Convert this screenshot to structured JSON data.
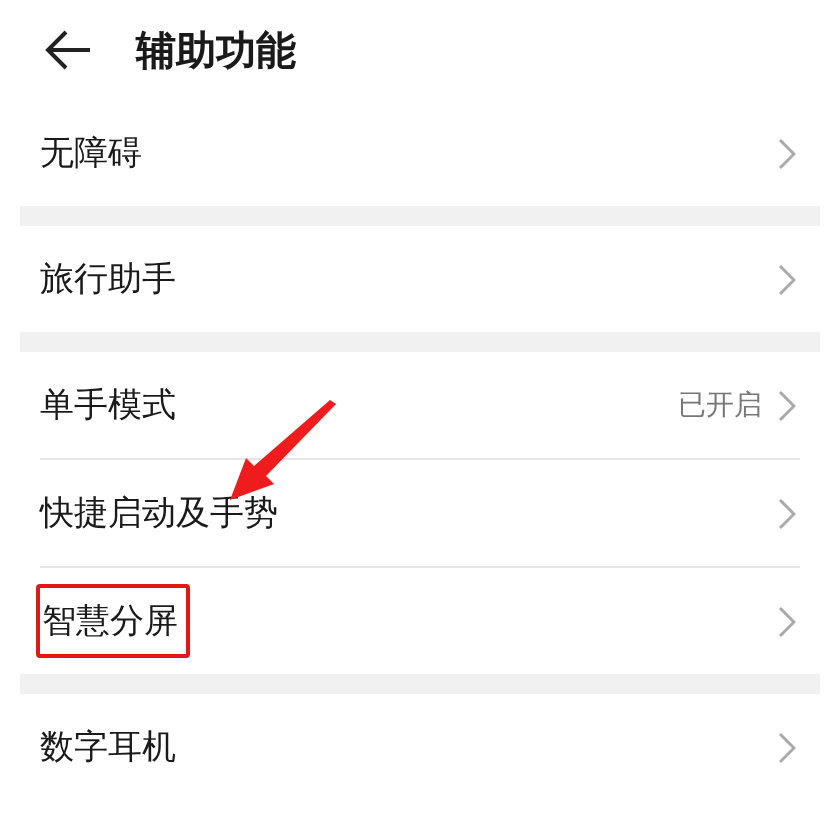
{
  "header": {
    "title": "辅助功能"
  },
  "sections": [
    {
      "items": [
        {
          "label": "无障碍",
          "highlighted": false
        }
      ]
    },
    {
      "items": [
        {
          "label": "旅行助手",
          "highlighted": false
        }
      ]
    },
    {
      "items": [
        {
          "label": "单手模式",
          "value": "已开启",
          "highlighted": false
        },
        {
          "label": "快捷启动及手势",
          "highlighted": false
        },
        {
          "label": "智慧分屏",
          "highlighted": true
        }
      ]
    },
    {
      "items": [
        {
          "label": "数字耳机",
          "highlighted": false
        }
      ]
    }
  ]
}
